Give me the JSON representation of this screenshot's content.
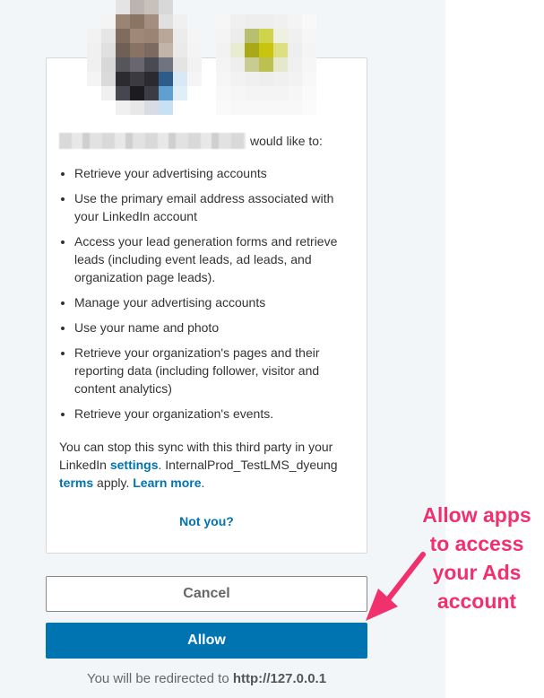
{
  "consent": {
    "would_like_to": "would like to:",
    "permissions": [
      "Retrieve your advertising accounts",
      "Use the primary email address associated with your LinkedIn account",
      "Access your lead generation forms and retrieve leads (including event leads, ad leads, and organization page leads).",
      "Manage your advertising accounts",
      "Use your name and photo",
      "Retrieve your organization's pages and their reporting data (including follower, visitor and content analytics)",
      "Retrieve your organization's events."
    ],
    "notice": {
      "part1": "You can stop this sync with this third party in your LinkedIn ",
      "settings_link": "settings",
      "part2": ". InternalProd_TestLMS_dyeung ",
      "terms_link": "terms",
      "part3": " apply. ",
      "learn_more_link": "Learn more",
      "part4": "."
    },
    "not_you": "Not you?"
  },
  "buttons": {
    "cancel": "Cancel",
    "allow": "Allow"
  },
  "redirect": {
    "prefix": "You will be redirected to ",
    "url": "http://127.0.0.1"
  },
  "annotation": {
    "lines": [
      "Allow apps",
      "to access",
      "your Ads",
      "account"
    ],
    "color": "#f0316e"
  },
  "colors": {
    "accent": "#0073b1",
    "background": "#f3f6f8"
  }
}
